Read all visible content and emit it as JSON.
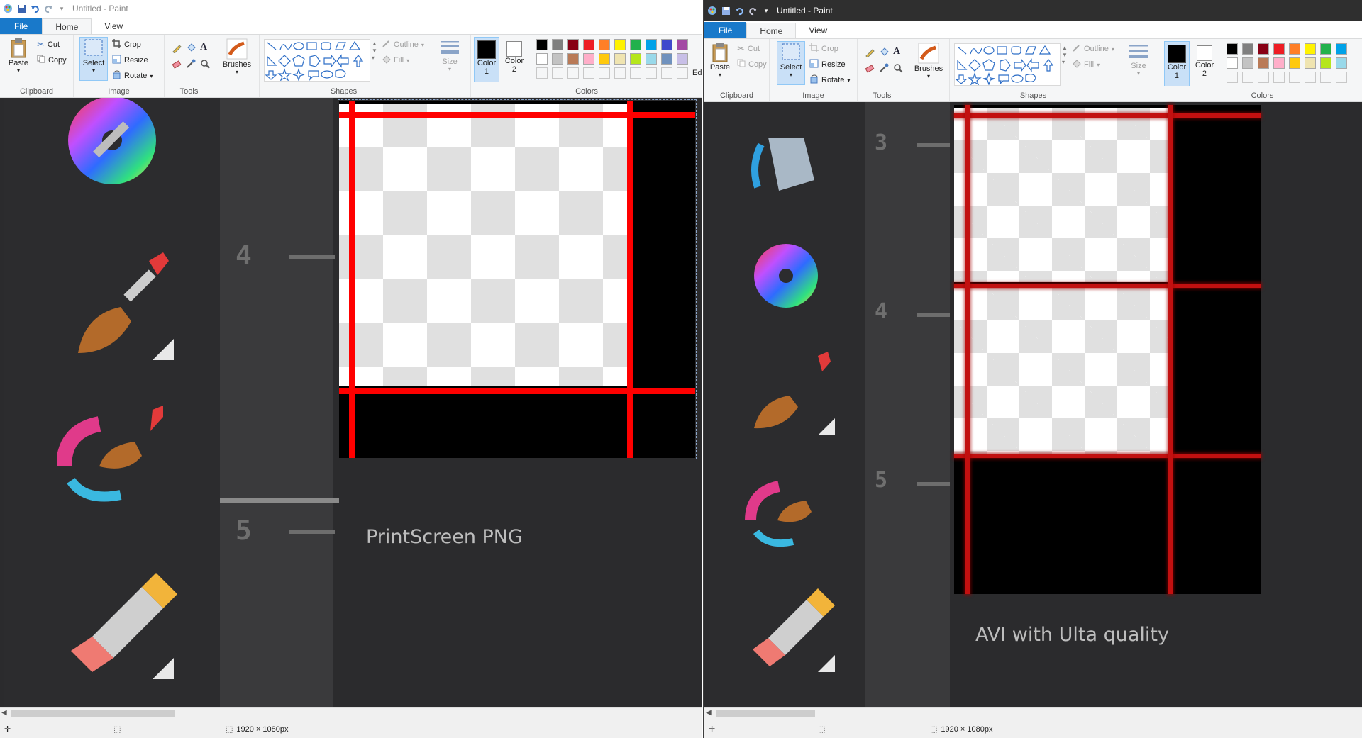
{
  "app": {
    "title": "Untitled - Paint"
  },
  "ribbon": {
    "tabs": [
      "File",
      "Home",
      "View"
    ],
    "clipboard": {
      "paste": "Paste",
      "cut": "Cut",
      "copy": "Copy",
      "label": "Clipboard"
    },
    "image": {
      "select": "Select",
      "crop": "Crop",
      "resize": "Resize",
      "rotate": "Rotate",
      "label": "Image"
    },
    "tools": {
      "label": "Tools"
    },
    "brushes": {
      "label": "Brushes"
    },
    "shapes": {
      "outline": "Outline",
      "fill": "Fill",
      "label": "Shapes"
    },
    "size": {
      "label": "Size"
    },
    "colors": {
      "color1": "Color\n1",
      "color2": "Color\n2",
      "label": "Colors",
      "edit_partial": "Ed co",
      "palette_row1": [
        "#000000",
        "#7f7f7f",
        "#880015",
        "#ed1c24",
        "#ff7f27",
        "#fff200",
        "#22b14c",
        "#00a2e8",
        "#3f48cc",
        "#a349a4"
      ],
      "palette_row2": [
        "#ffffff",
        "#c3c3c3",
        "#b97a57",
        "#ffaec9",
        "#ffc90e",
        "#efe4b0",
        "#b5e61d",
        "#99d9ea",
        "#7092be",
        "#c8bfe7"
      ]
    }
  },
  "status": {
    "size": "1920 × 1080px"
  },
  "canvas": {
    "left_caption": "PrintScreen PNG",
    "right_caption": "AVI with Ulta quality",
    "numbers_left": [
      "4",
      "5"
    ],
    "numbers_right": [
      "3",
      "4",
      "5"
    ]
  }
}
